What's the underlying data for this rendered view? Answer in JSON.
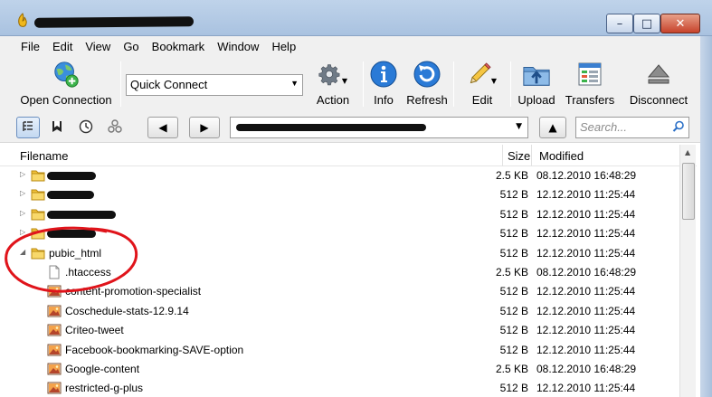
{
  "window": {
    "minimize_label": "–",
    "maximize_label": "□",
    "close_label": "✕"
  },
  "menu": [
    "File",
    "Edit",
    "View",
    "Go",
    "Bookmark",
    "Window",
    "Help"
  ],
  "toolbar": {
    "open_connection": "Open Connection",
    "quick_connect": "Quick Connect",
    "action": "Action",
    "info": "Info",
    "refresh": "Refresh",
    "edit": "Edit",
    "upload": "Upload",
    "transfers": "Transfers",
    "disconnect": "Disconnect"
  },
  "navbar": {
    "search_placeholder": "Search..."
  },
  "columns": {
    "filename": "Filename",
    "size": "Size",
    "modified": "Modified"
  },
  "files": [
    {
      "name": "",
      "size": "2.5 KB",
      "modified": "08.12.2010 16:48:29",
      "type": "folder",
      "expanded": false,
      "redacted": true
    },
    {
      "name": "",
      "size": "512 B",
      "modified": "12.12.2010 11:25:44",
      "type": "folder",
      "expanded": false,
      "redacted": true
    },
    {
      "name": "",
      "size": "512 B",
      "modified": "12.12.2010 11:25:44",
      "type": "folder",
      "expanded": false,
      "redacted": true
    },
    {
      "name": "",
      "size": "512 B",
      "modified": "12.12.2010 11:25:44",
      "type": "folder",
      "expanded": false,
      "redacted": true
    },
    {
      "name": "pubic_html",
      "size": "512 B",
      "modified": "12.12.2010 11:25:44",
      "type": "folder",
      "expanded": true
    },
    {
      "name": ".htaccess",
      "size": "2.5 KB",
      "modified": "08.12.2010 16:48:29",
      "type": "file"
    },
    {
      "name": "content-promotion-specialist",
      "size": "512 B",
      "modified": "12.12.2010 11:25:44",
      "type": "image"
    },
    {
      "name": "Coschedule-stats-12.9.14",
      "size": "512 B",
      "modified": "12.12.2010 11:25:44",
      "type": "image"
    },
    {
      "name": "Criteo-tweet",
      "size": "512 B",
      "modified": "12.12.2010 11:25:44",
      "type": "image"
    },
    {
      "name": "Facebook-bookmarking-SAVE-option",
      "size": "512 B",
      "modified": "12.12.2010 11:25:44",
      "type": "image"
    },
    {
      "name": "Google-content",
      "size": "2.5 KB",
      "modified": "08.12.2010 16:48:29",
      "type": "image"
    },
    {
      "name": "restricted-g-plus",
      "size": "512 B",
      "modified": "12.12.2010 11:25:44",
      "type": "image"
    }
  ],
  "colors": {
    "annotation": "#e0141b",
    "folder": "#f2c23c",
    "accent": "#1d6fd1"
  }
}
